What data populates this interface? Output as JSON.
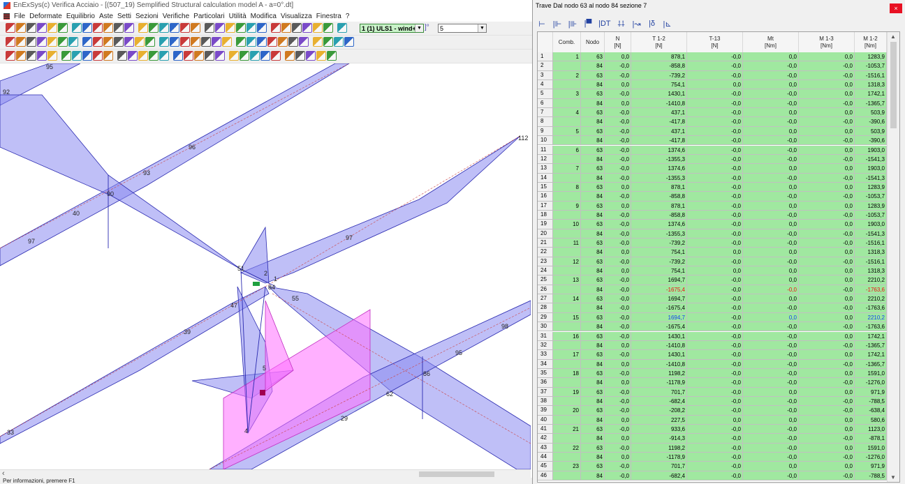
{
  "window": {
    "title": "EnExSys(c) Verifica Acciaio - [(507_19) Semplified Structural calculation model A - a=0°.dt]"
  },
  "menu": [
    "File",
    "Deformate",
    "Equilibrio",
    "Aste",
    "Setti",
    "Sezioni",
    "Verifiche",
    "Particolari",
    "Utilità",
    "Modifica",
    "Visualizza",
    "Finestra",
    "?"
  ],
  "toolbar": {
    "load_combo": "1 (1) ULS1 - wind+",
    "number_prefix": "]°",
    "number_value": "5"
  },
  "status": {
    "text": "Per informazioni, premere F1"
  },
  "canvas": {
    "labels": [
      {
        "id": "n95",
        "text": "95"
      },
      {
        "id": "n92",
        "text": "92"
      },
      {
        "id": "n96",
        "text": "96"
      },
      {
        "id": "n93",
        "text": "93"
      },
      {
        "id": "n90",
        "text": "90"
      },
      {
        "id": "n40",
        "text": "40"
      },
      {
        "id": "n97a",
        "text": "97"
      },
      {
        "id": "n97b",
        "text": "97"
      },
      {
        "id": "n51",
        "text": "51"
      },
      {
        "id": "n2",
        "text": "2"
      },
      {
        "id": "n1",
        "text": "1"
      },
      {
        "id": "n84",
        "text": "84"
      },
      {
        "id": "n55",
        "text": "55"
      },
      {
        "id": "n47",
        "text": "47"
      },
      {
        "id": "n39",
        "text": "39"
      },
      {
        "id": "n112",
        "text": "112"
      },
      {
        "id": "n98",
        "text": "98"
      },
      {
        "id": "n95b",
        "text": "95"
      },
      {
        "id": "n86",
        "text": "86"
      },
      {
        "id": "n5",
        "text": "5"
      },
      {
        "id": "n62",
        "text": "62"
      },
      {
        "id": "n29",
        "text": "29"
      },
      {
        "id": "n33",
        "text": "33"
      },
      {
        "id": "n4",
        "text": "4"
      }
    ],
    "colors": {
      "diagram_fill": "#8a8af0",
      "diagram_stroke": "#2a2ab0",
      "section_fill": "#ff80ff",
      "beam_line": "#cc4444"
    }
  },
  "panel": {
    "title": "Trave Dal nodo 63 al nodo 84  sezione 7",
    "close": "×",
    "tools": [
      "⊢",
      "|⊩",
      "|⊪",
      "|▀",
      "|DT",
      "⸸⸸",
      "|↝",
      "|δ",
      "|⊾"
    ],
    "columns": [
      {
        "key": "comb",
        "label": "Comb."
      },
      {
        "key": "nodo",
        "label": "Nodo"
      },
      {
        "key": "n",
        "label": "N\n[N]"
      },
      {
        "key": "t12",
        "label": "T 1-2\n[N]"
      },
      {
        "key": "t13",
        "label": "T-13\n[N]"
      },
      {
        "key": "mt",
        "label": "Mt\n[Nm]"
      },
      {
        "key": "m13",
        "label": "M 1-3\n[Nm]"
      },
      {
        "key": "m12",
        "label": "M 1-2\n[Nm]"
      }
    ],
    "rows": [
      {
        "idx": "1",
        "comb": "1",
        "nodo": "63",
        "n": "0,0",
        "t12": "878,1",
        "t13": "-0,0",
        "mt": "0,0",
        "m13": "0,0",
        "m12": "1283,9"
      },
      {
        "idx": "2",
        "comb": "",
        "nodo": "84",
        "n": "-0,0",
        "t12": "-858,8",
        "t13": "-0,0",
        "mt": "-0,0",
        "m13": "-0,0",
        "m12": "-1053,7"
      },
      {
        "idx": "3",
        "comb": "2",
        "nodo": "63",
        "n": "-0,0",
        "t12": "-739,2",
        "t13": "-0,0",
        "mt": "-0,0",
        "m13": "-0,0",
        "m12": "-1516,1"
      },
      {
        "idx": "4",
        "comb": "",
        "nodo": "84",
        "n": "0,0",
        "t12": "754,1",
        "t13": "0,0",
        "mt": "0,0",
        "m13": "0,0",
        "m12": "1318,3"
      },
      {
        "idx": "5",
        "comb": "3",
        "nodo": "63",
        "n": "-0,0",
        "t12": "1430,1",
        "t13": "-0,0",
        "mt": "-0,0",
        "m13": "0,0",
        "m12": "1742,1"
      },
      {
        "idx": "6",
        "comb": "",
        "nodo": "84",
        "n": "0,0",
        "t12": "-1410,8",
        "t13": "-0,0",
        "mt": "-0,0",
        "m13": "-0,0",
        "m12": "-1365,7"
      },
      {
        "idx": "7",
        "comb": "4",
        "nodo": "63",
        "n": "-0,0",
        "t12": "437,1",
        "t13": "-0,0",
        "mt": "0,0",
        "m13": "0,0",
        "m12": "503,9"
      },
      {
        "idx": "8",
        "comb": "",
        "nodo": "84",
        "n": "-0,0",
        "t12": "-417,8",
        "t13": "-0,0",
        "mt": "-0,0",
        "m13": "-0,0",
        "m12": "-390,6"
      },
      {
        "idx": "9",
        "comb": "5",
        "nodo": "63",
        "n": "-0,0",
        "t12": "437,1",
        "t13": "-0,0",
        "mt": "0,0",
        "m13": "0,0",
        "m12": "503,9"
      },
      {
        "idx": "10",
        "comb": "",
        "nodo": "84",
        "n": "-0,0",
        "t12": "-417,8",
        "t13": "-0,0",
        "mt": "-0,0",
        "m13": "-0,0",
        "m12": "-390,6"
      },
      {
        "idx": "11",
        "comb": "6",
        "nodo": "63",
        "n": "-0,0",
        "t12": "1374,6",
        "t13": "-0,0",
        "mt": "-0,0",
        "m13": "0,0",
        "m12": "1903,0"
      },
      {
        "idx": "12",
        "comb": "",
        "nodo": "84",
        "n": "-0,0",
        "t12": "-1355,3",
        "t13": "-0,0",
        "mt": "-0,0",
        "m13": "-0,0",
        "m12": "-1541,3"
      },
      {
        "idx": "13",
        "comb": "7",
        "nodo": "63",
        "n": "-0,0",
        "t12": "1374,6",
        "t13": "-0,0",
        "mt": "0,0",
        "m13": "0,0",
        "m12": "1903,0"
      },
      {
        "idx": "14",
        "comb": "",
        "nodo": "84",
        "n": "-0,0",
        "t12": "-1355,3",
        "t13": "-0,0",
        "mt": "-0,0",
        "m13": "-0,0",
        "m12": "-1541,3"
      },
      {
        "idx": "15",
        "comb": "8",
        "nodo": "63",
        "n": "0,0",
        "t12": "878,1",
        "t13": "-0,0",
        "mt": "0,0",
        "m13": "0,0",
        "m12": "1283,9"
      },
      {
        "idx": "16",
        "comb": "",
        "nodo": "84",
        "n": "-0,0",
        "t12": "-858,8",
        "t13": "-0,0",
        "mt": "-0,0",
        "m13": "-0,0",
        "m12": "-1053,7"
      },
      {
        "idx": "17",
        "comb": "9",
        "nodo": "63",
        "n": "0,0",
        "t12": "878,1",
        "t13": "-0,0",
        "mt": "0,0",
        "m13": "0,0",
        "m12": "1283,9"
      },
      {
        "idx": "18",
        "comb": "",
        "nodo": "84",
        "n": "-0,0",
        "t12": "-858,8",
        "t13": "-0,0",
        "mt": "-0,0",
        "m13": "-0,0",
        "m12": "-1053,7"
      },
      {
        "idx": "19",
        "comb": "10",
        "nodo": "63",
        "n": "-0,0",
        "t12": "1374,6",
        "t13": "-0,0",
        "mt": "0,0",
        "m13": "0,0",
        "m12": "1903,0"
      },
      {
        "idx": "20",
        "comb": "",
        "nodo": "84",
        "n": "-0,0",
        "t12": "-1355,3",
        "t13": "-0,0",
        "mt": "-0,0",
        "m13": "-0,0",
        "m12": "-1541,3"
      },
      {
        "idx": "21",
        "comb": "11",
        "nodo": "63",
        "n": "-0,0",
        "t12": "-739,2",
        "t13": "-0,0",
        "mt": "-0,0",
        "m13": "-0,0",
        "m12": "-1516,1"
      },
      {
        "idx": "22",
        "comb": "",
        "nodo": "84",
        "n": "0,0",
        "t12": "754,1",
        "t13": "0,0",
        "mt": "0,0",
        "m13": "0,0",
        "m12": "1318,3"
      },
      {
        "idx": "23",
        "comb": "12",
        "nodo": "63",
        "n": "-0,0",
        "t12": "-739,2",
        "t13": "-0,0",
        "mt": "-0,0",
        "m13": "-0,0",
        "m12": "-1516,1"
      },
      {
        "idx": "24",
        "comb": "",
        "nodo": "84",
        "n": "0,0",
        "t12": "754,1",
        "t13": "0,0",
        "mt": "0,0",
        "m13": "0,0",
        "m12": "1318,3"
      },
      {
        "idx": "25",
        "comb": "13",
        "nodo": "63",
        "n": "-0,0",
        "t12": "1694,7",
        "t13": "-0,0",
        "mt": "0,0",
        "m13": "0,0",
        "m12": "2210,2"
      },
      {
        "idx": "26",
        "comb": "",
        "nodo": "84",
        "n": "-0,0",
        "t12": "-1675,4",
        "t13": "-0,0",
        "mt": "-0,0",
        "m13": "-0,0",
        "m12": "-1763,6",
        "hl": "red"
      },
      {
        "idx": "27",
        "comb": "14",
        "nodo": "63",
        "n": "-0,0",
        "t12": "1694,7",
        "t13": "-0,0",
        "mt": "0,0",
        "m13": "0,0",
        "m12": "2210,2"
      },
      {
        "idx": "28",
        "comb": "",
        "nodo": "84",
        "n": "-0,0",
        "t12": "-1675,4",
        "t13": "-0,0",
        "mt": "-0,0",
        "m13": "-0,0",
        "m12": "-1763,6"
      },
      {
        "idx": "29",
        "comb": "15",
        "nodo": "63",
        "n": "-0,0",
        "t12": "1694,7",
        "t13": "-0,0",
        "mt": "0,0",
        "m13": "0,0",
        "m12": "2210,2",
        "hl": "blue"
      },
      {
        "idx": "30",
        "comb": "",
        "nodo": "84",
        "n": "-0,0",
        "t12": "-1675,4",
        "t13": "-0,0",
        "mt": "-0,0",
        "m13": "-0,0",
        "m12": "-1763,6"
      },
      {
        "idx": "31",
        "comb": "16",
        "nodo": "63",
        "n": "-0,0",
        "t12": "1430,1",
        "t13": "-0,0",
        "mt": "-0,0",
        "m13": "0,0",
        "m12": "1742,1"
      },
      {
        "idx": "32",
        "comb": "",
        "nodo": "84",
        "n": "0,0",
        "t12": "-1410,8",
        "t13": "-0,0",
        "mt": "-0,0",
        "m13": "-0,0",
        "m12": "-1365,7"
      },
      {
        "idx": "33",
        "comb": "17",
        "nodo": "63",
        "n": "-0,0",
        "t12": "1430,1",
        "t13": "-0,0",
        "mt": "-0,0",
        "m13": "0,0",
        "m12": "1742,1"
      },
      {
        "idx": "34",
        "comb": "",
        "nodo": "84",
        "n": "0,0",
        "t12": "-1410,8",
        "t13": "-0,0",
        "mt": "-0,0",
        "m13": "-0,0",
        "m12": "-1365,7"
      },
      {
        "idx": "35",
        "comb": "18",
        "nodo": "63",
        "n": "-0,0",
        "t12": "1198,2",
        "t13": "-0,0",
        "mt": "-0,0",
        "m13": "0,0",
        "m12": "1591,0"
      },
      {
        "idx": "36",
        "comb": "",
        "nodo": "84",
        "n": "0,0",
        "t12": "-1178,9",
        "t13": "-0,0",
        "mt": "-0,0",
        "m13": "-0,0",
        "m12": "-1276,0"
      },
      {
        "idx": "37",
        "comb": "19",
        "nodo": "63",
        "n": "-0,0",
        "t12": "701,7",
        "t13": "-0,0",
        "mt": "0,0",
        "m13": "0,0",
        "m12": "971,9"
      },
      {
        "idx": "38",
        "comb": "",
        "nodo": "84",
        "n": "-0,0",
        "t12": "-682,4",
        "t13": "-0,0",
        "mt": "-0,0",
        "m13": "-0,0",
        "m12": "-788,5"
      },
      {
        "idx": "39",
        "comb": "20",
        "nodo": "63",
        "n": "-0,0",
        "t12": "-208,2",
        "t13": "-0,0",
        "mt": "-0,0",
        "m13": "-0,0",
        "m12": "-638,4"
      },
      {
        "idx": "40",
        "comb": "",
        "nodo": "84",
        "n": "0,0",
        "t12": "227,5",
        "t13": "0,0",
        "mt": "0,0",
        "m13": "0,0",
        "m12": "580,6"
      },
      {
        "idx": "41",
        "comb": "21",
        "nodo": "63",
        "n": "-0,0",
        "t12": "933,6",
        "t13": "-0,0",
        "mt": "-0,0",
        "m13": "0,0",
        "m12": "1123,0"
      },
      {
        "idx": "42",
        "comb": "",
        "nodo": "84",
        "n": "0,0",
        "t12": "-914,3",
        "t13": "-0,0",
        "mt": "-0,0",
        "m13": "-0,0",
        "m12": "-878,1"
      },
      {
        "idx": "43",
        "comb": "22",
        "nodo": "63",
        "n": "-0,0",
        "t12": "1198,2",
        "t13": "-0,0",
        "mt": "-0,0",
        "m13": "0,0",
        "m12": "1591,0"
      },
      {
        "idx": "44",
        "comb": "",
        "nodo": "84",
        "n": "0,0",
        "t12": "-1178,9",
        "t13": "-0,0",
        "mt": "-0,0",
        "m13": "-0,0",
        "m12": "-1276,0"
      },
      {
        "idx": "45",
        "comb": "23",
        "nodo": "63",
        "n": "-0,0",
        "t12": "701,7",
        "t13": "-0,0",
        "mt": "0,0",
        "m13": "0,0",
        "m12": "971,9"
      },
      {
        "idx": "46",
        "comb": "",
        "nodo": "84",
        "n": "-0,0",
        "t12": "-682,4",
        "t13": "-0,0",
        "mt": "-0,0",
        "m13": "-0,0",
        "m12": "-788,5"
      }
    ]
  }
}
